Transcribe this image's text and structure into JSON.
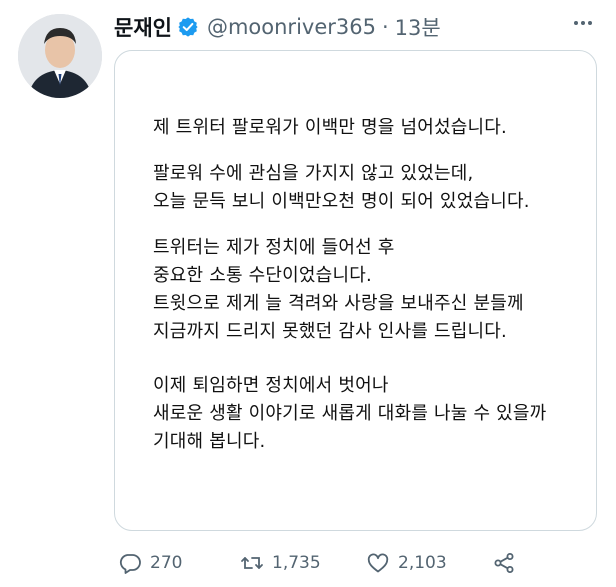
{
  "tweet": {
    "author_name": "문재인",
    "handle": "@moonriver365",
    "separator": "·",
    "time": "13분",
    "paragraphs": [
      [
        "제 트위터 팔로워가 이백만 명을 넘어섰습니다."
      ],
      [
        "팔로워 수에 관심을 가지지 않고 있었는데,",
        "오늘 문득 보니 이백만오천 명이 되어 있었습니다."
      ],
      [
        "트위터는 제가 정치에 들어선 후",
        "중요한 소통 수단이었습니다.",
        "트윗으로 제게 늘 격려와 사랑을 보내주신 분들께",
        "지금까지 드리지 못했던 감사 인사를 드립니다."
      ],
      [
        "이제 퇴임하면 정치에서 벗어나",
        "새로운 생활 이야기로 새롭게 대화를 나눌 수 있을까",
        "기대해 봅니다."
      ]
    ],
    "actions": {
      "replies": "270",
      "retweets": "1,735",
      "likes": "2,103"
    }
  },
  "colors": {
    "verified": "#1d9bf0",
    "muted": "#536471",
    "border": "#cfd9de"
  },
  "icons": [
    "avatar",
    "verified-icon",
    "more-icon",
    "reply-icon",
    "retweet-icon",
    "like-icon",
    "share-icon"
  ]
}
